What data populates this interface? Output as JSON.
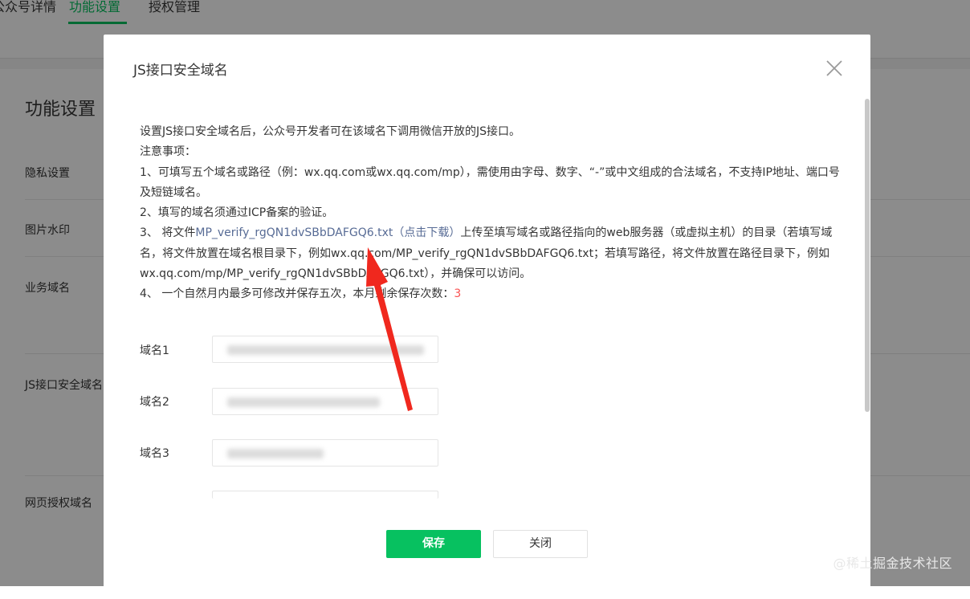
{
  "background": {
    "tabs": [
      {
        "label": "公众号详情",
        "active": false
      },
      {
        "label": "功能设置",
        "active": true
      },
      {
        "label": "授权管理",
        "active": false
      }
    ],
    "title": "功能设置",
    "items": [
      "隐私设置",
      "图片水印",
      "业务域名",
      "JS接口安全域名",
      "网页授权域名"
    ]
  },
  "dialog": {
    "title": "JS接口安全域名",
    "close_icon": "close-icon",
    "notes": {
      "line_intro": "设置JS接口安全域名后，公众号开发者可在该域名下调用微信开放的JS接口。",
      "line_heading": "注意事项：",
      "line_1": "1、可填写五个域名或路径（例：wx.qq.com或wx.qq.com/mp），需使用由字母、数字、“-”或中文组成的合法域名，不支持IP地址、端口号及短链域名。",
      "line_2": "2、填写的域名须通过ICP备案的验证。",
      "line_3_prefix": "3、 将文件",
      "line_3_link": "MP_verify_rgQN1dvSBbDAFGQ6.txt（点击下载）",
      "line_3_suffix": "上传至填写域名或路径指向的web服务器（或虚拟主机）的目录（若填写域名，将文件放置在域名根目录下，例如wx.qq.com/MP_verify_rgQN1dvSBbDAFGQ6.txt；若填写路径，将文件放置在路径目录下，例如wx.qq.com/mp/MP_verify_rgQN1dvSBbDAFGQ6.txt），并确保可以访问。",
      "line_4_prefix": "4、 一个自然月内最多可修改并保存五次，本月剩余保存次数：",
      "line_4_count": "3"
    },
    "fields": [
      {
        "label": "域名1"
      },
      {
        "label": "域名2"
      },
      {
        "label": "域名3"
      },
      {
        "label": ""
      }
    ],
    "buttons": {
      "save": "保存",
      "close": "关闭"
    }
  },
  "watermark": "@稀土掘金技术社区",
  "colors": {
    "accent": "#07c160",
    "link": "#576b95",
    "alert": "#fa5151"
  }
}
